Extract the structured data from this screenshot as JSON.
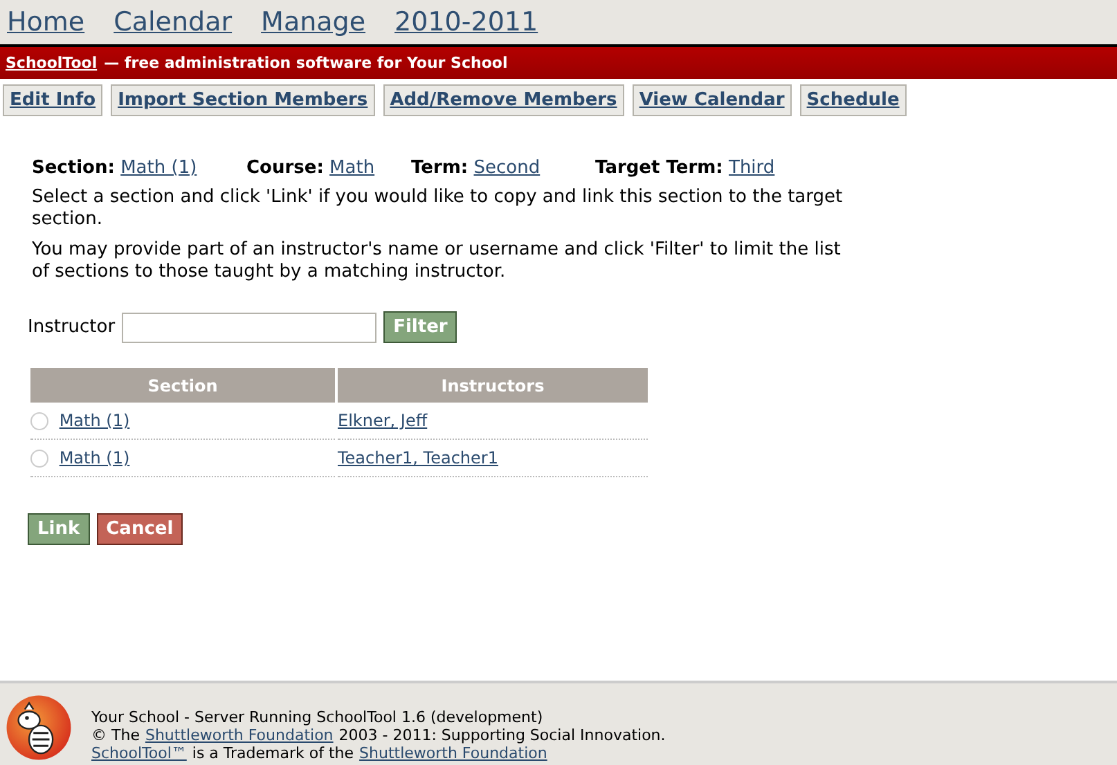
{
  "top_nav": [
    "Home",
    "Calendar",
    "Manage",
    "2010-2011"
  ],
  "banner": {
    "link": "SchoolTool",
    "text": "— free administration software for Your School"
  },
  "action_buttons": [
    "Edit Info",
    "Import Section Members",
    "Add/Remove Members",
    "View Calendar",
    "Schedule"
  ],
  "info": [
    {
      "label": "Section:",
      "value": "Math (1)"
    },
    {
      "label": "Course:",
      "value": "Math"
    },
    {
      "label": "Term:",
      "value": "Second"
    },
    {
      "label": "Target Term:",
      "value": "Third"
    }
  ],
  "instructions": [
    "Select a section and click 'Link' if you would like to copy and link this section to the target section.",
    "You may provide part of an instructor's name or username and click 'Filter' to limit the list of sections to those taught by a matching instructor."
  ],
  "filter": {
    "label": "Instructor",
    "button": "Filter"
  },
  "table": {
    "columns": [
      "Section",
      "Instructors"
    ],
    "rows": [
      {
        "section": "Math (1)",
        "instructors": "Elkner, Jeff",
        "selected": false
      },
      {
        "section": "Math (1)",
        "instructors": "Teacher1, Teacher1",
        "selected": false
      }
    ]
  },
  "form_buttons": [
    {
      "label": "Link",
      "kind": "submit"
    },
    {
      "label": "Cancel",
      "kind": "cancel"
    }
  ],
  "footer": {
    "lines": [
      [
        {
          "text": "Your School - Server Running SchoolTool 1.6 (development)",
          "link": false
        }
      ],
      [
        {
          "text": "© The",
          "link": false
        },
        {
          "text": "Shuttleworth Foundation",
          "link": true
        },
        {
          "text": "2003 - 2011: Supporting Social Innovation.",
          "link": false
        }
      ],
      [
        {
          "text": "SchoolTool™",
          "link": true
        },
        {
          "text": "is a Trademark of the",
          "link": false
        },
        {
          "text": "Shuttleworth Foundation",
          "link": true
        }
      ]
    ]
  }
}
